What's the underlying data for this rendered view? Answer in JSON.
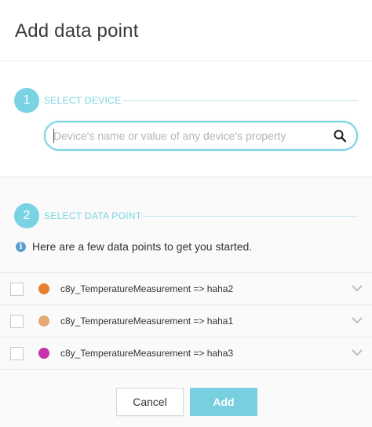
{
  "dialog": {
    "title": "Add data point"
  },
  "step1": {
    "number": "1",
    "label": "SELECT DEVICE"
  },
  "search": {
    "placeholder": "Device's name or value of any device's property",
    "value": "",
    "icon": "search-icon"
  },
  "step2": {
    "number": "2",
    "label": "SELECT DATA POINT"
  },
  "info": {
    "icon": "info-icon",
    "text": "Here are a few data points to get you started."
  },
  "datapoints": [
    {
      "label": "c8y_TemperatureMeasurement => haha2",
      "color": "#e97f2c",
      "checked": false
    },
    {
      "label": "c8y_TemperatureMeasurement => haha1",
      "color": "#e3a873",
      "checked": false
    },
    {
      "label": "c8y_TemperatureMeasurement => haha3",
      "color": "#c534ad",
      "checked": false
    }
  ],
  "footer": {
    "cancel_label": "Cancel",
    "add_label": "Add"
  },
  "colors": {
    "accent": "#7ad3e3",
    "add_button": "#78cfdf"
  }
}
